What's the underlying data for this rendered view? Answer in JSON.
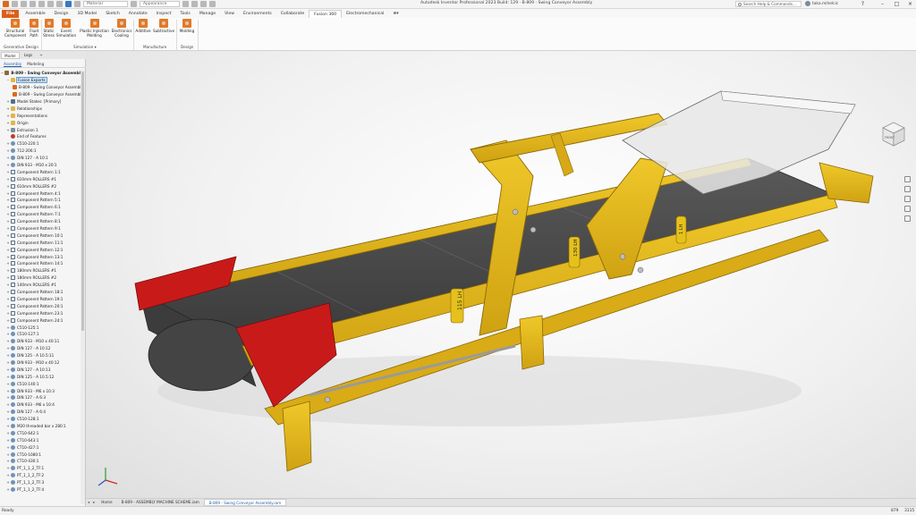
{
  "titlebar": {
    "material_placeholder": "Material",
    "appearance_placeholder": "Appearance",
    "window_title": "Autodesk Inventor Professional 2023 Build: 129 · B-809 · Swing Conveyor Assembly",
    "search_help": "Search Help & Commands...",
    "user_name": "taka.mihelcic",
    "help_icon": "?"
  },
  "ribbon_tabs": [
    "File",
    "Assemble",
    "Design",
    "3D Model",
    "Sketch",
    "Annotate",
    "Inspect",
    "Tools",
    "Manage",
    "View",
    "Environments",
    "Collaborate",
    "Fusion 360",
    "Electromechanical",
    "⊕▾"
  ],
  "active_tab": "Fusion 360",
  "ribbon": {
    "structural_component": "Structural Component",
    "fluid_path": "Fluid Path",
    "static_stress": "Static Stress",
    "event_simulation": "Event Simulation",
    "plastic_injection_molding": "Plastic Injection Molding",
    "electronics_cooling": "Electronics Cooling",
    "additive": "Additive",
    "subtractive": "Subtractive",
    "molding": "Molding",
    "group_generative": "Generative Design",
    "group_simulation": "Simulation ▾",
    "group_manufacture": "Manufacture",
    "group_design": "Design"
  },
  "browser": {
    "tabs": [
      "Model",
      "Logs",
      "+"
    ],
    "subtabs": [
      "Assembly",
      "Modeling"
    ],
    "tree": [
      {
        "label": "B-809 - Swing Conveyor Assembly.ia",
        "indent": 0,
        "icon": "asm",
        "expander": "−",
        "bold": true
      },
      {
        "label": "Fusion Exports",
        "indent": 1,
        "icon": "fold",
        "expander": "−",
        "selected": true
      },
      {
        "label": "B-809 - Swing Conveyor Assembly.i",
        "indent": 2,
        "icon": "fus",
        "expander": ""
      },
      {
        "label": "B-809 - Swing Conveyor Assembly_i",
        "indent": 2,
        "icon": "fus",
        "expander": ""
      },
      {
        "label": "Model States: [Primary]",
        "indent": 1,
        "icon": "ms",
        "expander": "+"
      },
      {
        "label": "Relationships",
        "indent": 1,
        "icon": "fold",
        "expander": "+"
      },
      {
        "label": "Representations",
        "indent": 1,
        "icon": "fold",
        "expander": "+"
      },
      {
        "label": "Origin",
        "indent": 1,
        "icon": "fold",
        "expander": "+"
      },
      {
        "label": "Extrusion 1",
        "indent": 1,
        "icon": "ext",
        "expander": "+"
      },
      {
        "label": "End of Features",
        "indent": 1,
        "icon": "end",
        "expander": ""
      },
      {
        "label": "C510-220:1",
        "indent": 1,
        "icon": "part",
        "expander": "+"
      },
      {
        "label": "712-206:1",
        "indent": 1,
        "icon": "part",
        "expander": "+"
      },
      {
        "label": "DIN 127 - A 10:1",
        "indent": 1,
        "icon": "part",
        "expander": "+"
      },
      {
        "label": "DIN 933 - M10 x 20:1",
        "indent": 1,
        "icon": "part",
        "expander": "+"
      },
      {
        "label": "Component Pattern 1:1",
        "indent": 1,
        "icon": "pat",
        "expander": "+"
      },
      {
        "label": "610mm ROLLERS #1",
        "indent": 1,
        "icon": "pat",
        "expander": "+"
      },
      {
        "label": "610mm ROLLERS #2",
        "indent": 1,
        "icon": "pat",
        "expander": "+"
      },
      {
        "label": "Component Pattern 4:1",
        "indent": 1,
        "icon": "pat",
        "expander": "+"
      },
      {
        "label": "Component Pattern 5:1",
        "indent": 1,
        "icon": "pat",
        "expander": "+"
      },
      {
        "label": "Component Pattern 6:1",
        "indent": 1,
        "icon": "pat",
        "expander": "+"
      },
      {
        "label": "Component Pattern 7:1",
        "indent": 1,
        "icon": "pat",
        "expander": "+"
      },
      {
        "label": "Component Pattern 8:1",
        "indent": 1,
        "icon": "pat",
        "expander": "+"
      },
      {
        "label": "Component Pattern 9:1",
        "indent": 1,
        "icon": "pat",
        "expander": "+"
      },
      {
        "label": "Component Pattern 10:1",
        "indent": 1,
        "icon": "pat",
        "expander": "+"
      },
      {
        "label": "Component Pattern 11:1",
        "indent": 1,
        "icon": "pat",
        "expander": "+"
      },
      {
        "label": "Component Pattern 12:1",
        "indent": 1,
        "icon": "pat",
        "expander": "+"
      },
      {
        "label": "Component Pattern 13:1",
        "indent": 1,
        "icon": "pat",
        "expander": "+"
      },
      {
        "label": "Component Pattern 14:1",
        "indent": 1,
        "icon": "pat",
        "expander": "+"
      },
      {
        "label": "180mm ROLLERS #1",
        "indent": 1,
        "icon": "pat",
        "expander": "+"
      },
      {
        "label": "180mm ROLLERS #2",
        "indent": 1,
        "icon": "pat",
        "expander": "+"
      },
      {
        "label": "140mm ROLLERS #1",
        "indent": 1,
        "icon": "pat",
        "expander": "+"
      },
      {
        "label": "Component Pattern 18:1",
        "indent": 1,
        "icon": "pat",
        "expander": "+"
      },
      {
        "label": "Component Pattern 19:1",
        "indent": 1,
        "icon": "pat",
        "expander": "+"
      },
      {
        "label": "Component Pattern 20:1",
        "indent": 1,
        "icon": "pat",
        "expander": "+"
      },
      {
        "label": "Component Pattern 23:1",
        "indent": 1,
        "icon": "pat",
        "expander": "+"
      },
      {
        "label": "Component Pattern 24:1",
        "indent": 1,
        "icon": "pat",
        "expander": "+"
      },
      {
        "label": "C510-125:1",
        "indent": 1,
        "icon": "part",
        "expander": "+"
      },
      {
        "label": "C510-127:1",
        "indent": 1,
        "icon": "part",
        "expander": "+"
      },
      {
        "label": "DIN 933 - M10 x 40:11",
        "indent": 1,
        "icon": "part",
        "expander": "+"
      },
      {
        "label": "DIN 127 - A 10:12",
        "indent": 1,
        "icon": "part",
        "expander": "+"
      },
      {
        "label": "DIN 125 - A 10.5:11",
        "indent": 1,
        "icon": "part",
        "expander": "+"
      },
      {
        "label": "DIN 933 - M10 x 40:12",
        "indent": 1,
        "icon": "part",
        "expander": "+"
      },
      {
        "label": "DIN 127 - A 10:13",
        "indent": 1,
        "icon": "part",
        "expander": "+"
      },
      {
        "label": "DIN 125 - A 10.5:12",
        "indent": 1,
        "icon": "part",
        "expander": "+"
      },
      {
        "label": "C510-140:1",
        "indent": 1,
        "icon": "part",
        "expander": "+"
      },
      {
        "label": "DIN 933 - M6 x 10:3",
        "indent": 1,
        "icon": "part",
        "expander": "+"
      },
      {
        "label": "DIN 127 - A 6:3",
        "indent": 1,
        "icon": "part",
        "expander": "+"
      },
      {
        "label": "DIN 933 - M6 x 10:4",
        "indent": 1,
        "icon": "part",
        "expander": "+"
      },
      {
        "label": "DIN 127 - A 6:4",
        "indent": 1,
        "icon": "part",
        "expander": "+"
      },
      {
        "label": "C510-128:1",
        "indent": 1,
        "icon": "part",
        "expander": "+"
      },
      {
        "label": "M20 threaded bar x 280:1",
        "indent": 1,
        "icon": "part",
        "expander": "+"
      },
      {
        "label": "CT10-642:1",
        "indent": 1,
        "icon": "part",
        "expander": "+"
      },
      {
        "label": "CT10-643:1",
        "indent": 1,
        "icon": "part",
        "expander": "+"
      },
      {
        "label": "CT10-427:1",
        "indent": 1,
        "icon": "part",
        "expander": "+"
      },
      {
        "label": "CT10-1080:1",
        "indent": 1,
        "icon": "part",
        "expander": "+"
      },
      {
        "label": "CT10-430:1",
        "indent": 1,
        "icon": "part",
        "expander": "+"
      },
      {
        "label": "PT_1_1_2_TF:1",
        "indent": 1,
        "icon": "part",
        "expander": "+"
      },
      {
        "label": "PT_1_1_2_TF:2",
        "indent": 1,
        "icon": "part",
        "expander": "+"
      },
      {
        "label": "PT_1_1_2_TF:3",
        "indent": 1,
        "icon": "part",
        "expander": "+"
      },
      {
        "label": "PT_1_1_2_TF:4",
        "indent": 1,
        "icon": "part",
        "expander": "+"
      }
    ]
  },
  "viewport": {
    "roller_labels": [
      "115 LH",
      "130 LH",
      "1 LH"
    ],
    "viewcube_face": "FRONT"
  },
  "doc_tabs": [
    "Home",
    "B-809 - ASSEMBLY MACHINE SCHEME.iam",
    "B-809 - Swing Conveyor Assembly.iam"
  ],
  "active_doc": "B-809 - Swing Conveyor Assembly.iam",
  "status": {
    "left": "Ready",
    "num1": "879",
    "num2": "3115"
  },
  "colors": {
    "frame": "#e3b91a",
    "belt": "#4a4a4a",
    "guard": "#c91a1a",
    "file_tab": "#d9601c"
  }
}
